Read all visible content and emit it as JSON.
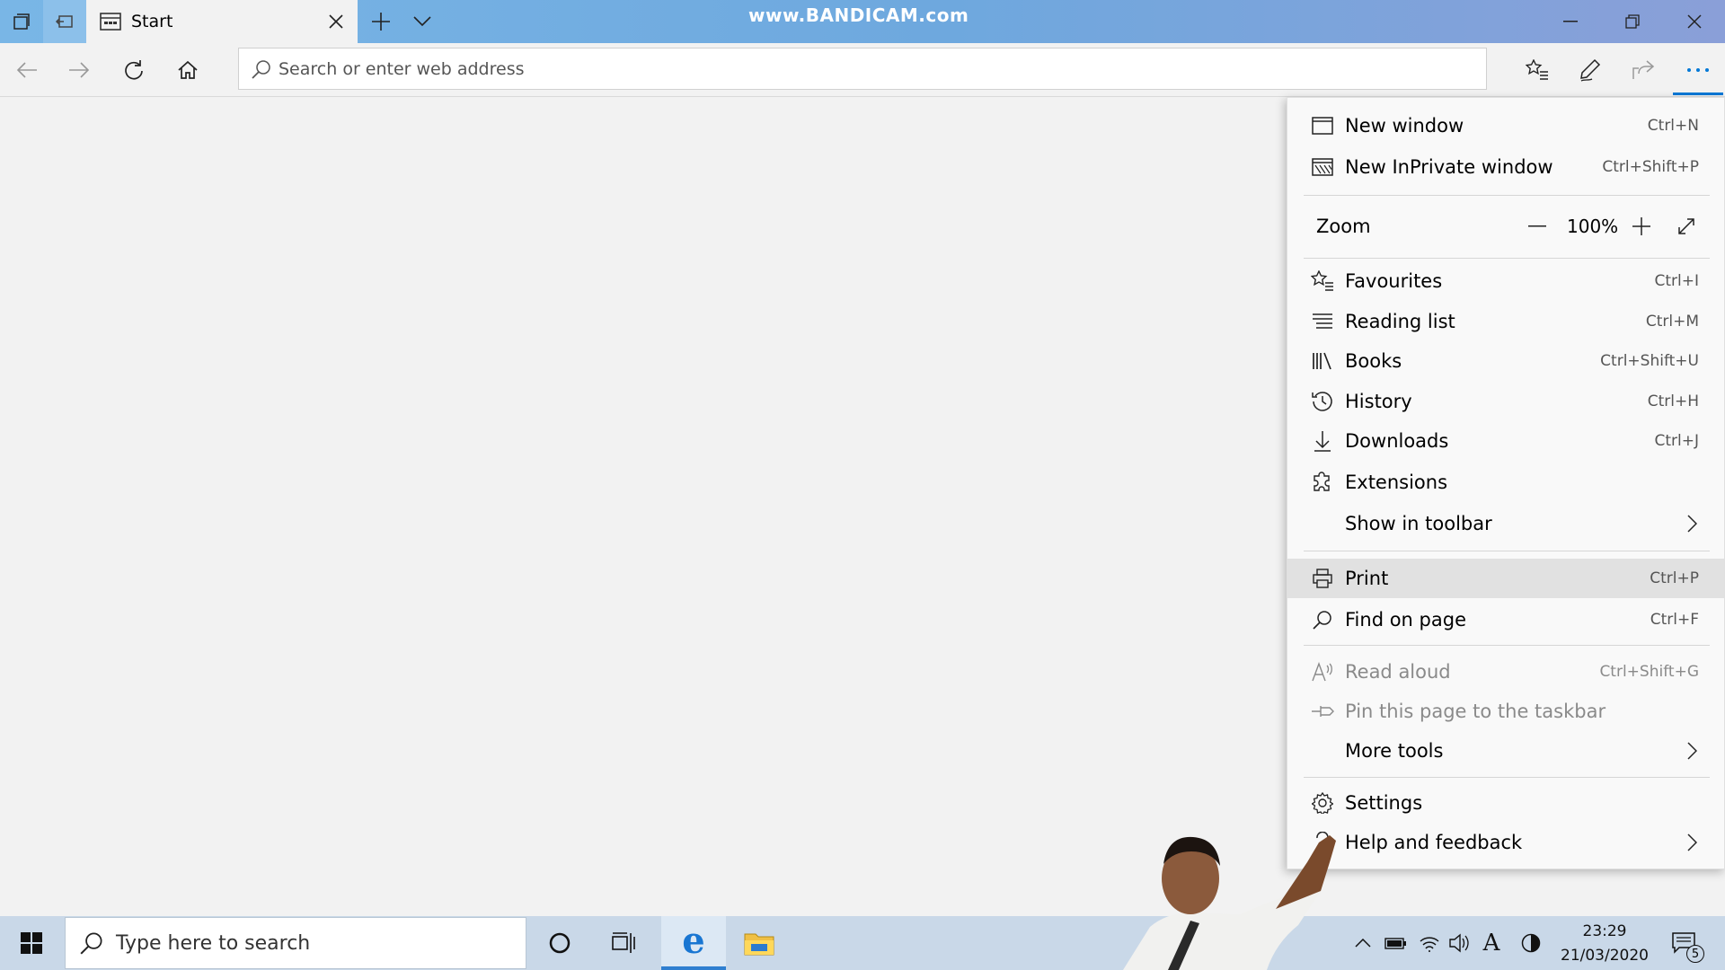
{
  "watermark": "www.BANDICAM.com",
  "tab": {
    "title": "Start"
  },
  "address": {
    "placeholder": "Search or enter web address"
  },
  "menu": {
    "new_window": {
      "label": "New window",
      "shortcut": "Ctrl+N"
    },
    "new_inprivate": {
      "label": "New InPrivate window",
      "shortcut": "Ctrl+Shift+P"
    },
    "zoom": {
      "label": "Zoom",
      "value": "100%"
    },
    "favourites": {
      "label": "Favourites",
      "shortcut": "Ctrl+I"
    },
    "reading_list": {
      "label": "Reading list",
      "shortcut": "Ctrl+M"
    },
    "books": {
      "label": "Books",
      "shortcut": "Ctrl+Shift+U"
    },
    "history": {
      "label": "History",
      "shortcut": "Ctrl+H"
    },
    "downloads": {
      "label": "Downloads",
      "shortcut": "Ctrl+J"
    },
    "extensions": {
      "label": "Extensions"
    },
    "show_in_toolbar": {
      "label": "Show in toolbar"
    },
    "print": {
      "label": "Print",
      "shortcut": "Ctrl+P"
    },
    "find_on_page": {
      "label": "Find on page",
      "shortcut": "Ctrl+F"
    },
    "read_aloud": {
      "label": "Read aloud",
      "shortcut": "Ctrl+Shift+G"
    },
    "pin_taskbar": {
      "label": "Pin this page to the taskbar"
    },
    "more_tools": {
      "label": "More tools"
    },
    "settings": {
      "label": "Settings"
    },
    "help_feedback": {
      "label": "Help and feedback"
    }
  },
  "taskbar": {
    "search_placeholder": "Type here to search",
    "time": "23:29",
    "date": "21/03/2020",
    "notification_count": "5"
  },
  "colors": {
    "accent": "#0078d7",
    "titlebar": "#79b6e6",
    "taskbar": "#c9d8e8"
  }
}
